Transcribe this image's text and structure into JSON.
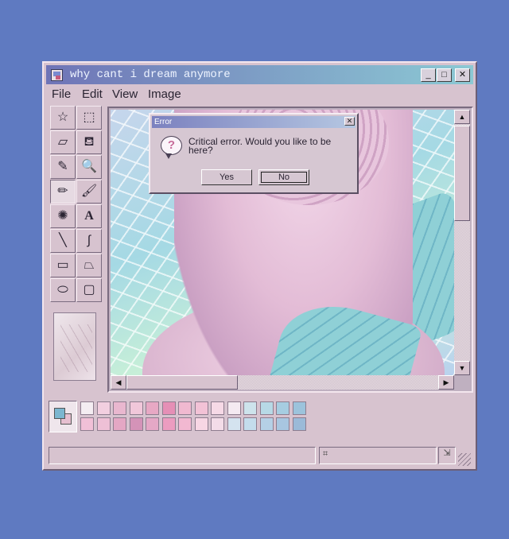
{
  "window": {
    "title": "why cant i dream anymore",
    "controls": {
      "minimize": "_",
      "maximize": "□",
      "close": "✕"
    }
  },
  "menubar": {
    "items": [
      {
        "label": "File",
        "accel": "F"
      },
      {
        "label": "Edit",
        "accel": "E"
      },
      {
        "label": "View",
        "accel": "V"
      },
      {
        "label": "Image",
        "accel": "I"
      }
    ]
  },
  "tools": [
    {
      "name": "free-form-select",
      "icon": "☆"
    },
    {
      "name": "rect-select",
      "icon": "⬚"
    },
    {
      "name": "eraser",
      "icon": "▱"
    },
    {
      "name": "fill",
      "icon": "⛾"
    },
    {
      "name": "color-picker",
      "icon": "✎"
    },
    {
      "name": "magnifier",
      "icon": "🔍"
    },
    {
      "name": "pencil",
      "icon": "✏"
    },
    {
      "name": "brush",
      "icon": "🖌"
    },
    {
      "name": "airbrush",
      "icon": "✺"
    },
    {
      "name": "text",
      "icon": "A"
    },
    {
      "name": "line",
      "icon": "╲"
    },
    {
      "name": "curve",
      "icon": "∫"
    },
    {
      "name": "rectangle",
      "icon": "▭"
    },
    {
      "name": "polygon",
      "icon": "⏢"
    },
    {
      "name": "ellipse",
      "icon": "⬭"
    },
    {
      "name": "rounded-rect",
      "icon": "▢"
    }
  ],
  "palette": {
    "foreground": "#7bb6cf",
    "background": "#e6bfd0",
    "row1": [
      "#f4edf2",
      "#f2cfe0",
      "#e9b7cf",
      "#f1c7da",
      "#e7a8c4",
      "#e58fb6",
      "#f0b9d0",
      "#f2c2d6",
      "#f6d9e6",
      "#f4eaf1",
      "#cde3ec",
      "#b7d9e6",
      "#a6cde1",
      "#9cc3dc"
    ],
    "row2": [
      "#f1c0d7",
      "#eec0d6",
      "#e4a7c4",
      "#d493b8",
      "#e5a8c6",
      "#ec9cc0",
      "#f2b8d1",
      "#f7d6e4",
      "#f3dce8",
      "#d4e3ef",
      "#c4dcec",
      "#b5d0e6",
      "#a8c6e0",
      "#9bbad8"
    ]
  },
  "dialog": {
    "title": "Error",
    "close": "✕",
    "icon": "?",
    "message": "Critical error. Would you like to be here?",
    "yes": "Yes",
    "no": "No"
  },
  "statusbar": {
    "position_icon": "⌗",
    "size_icon": "⇲"
  }
}
